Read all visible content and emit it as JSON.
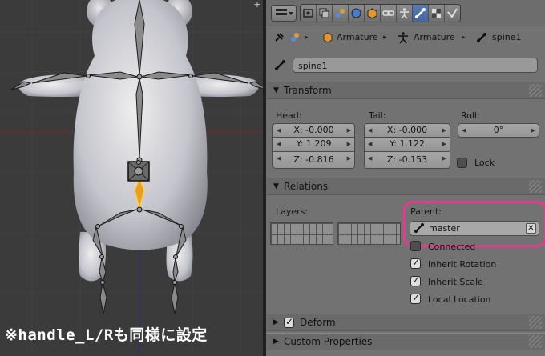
{
  "caption": "※handle_L/Rも同様に設定",
  "header": {
    "context_tabs": [
      "render-icon",
      "render-layers-icon",
      "scene-icon",
      "world-icon",
      "object-icon",
      "constraints-icon",
      "object-data-icon",
      "bone-icon",
      "bone-constraints-icon",
      "material-icon"
    ],
    "active_tab": "bone-icon"
  },
  "breadcrumb": {
    "item1": "Armature",
    "item2": "Armature",
    "item3": "spine1"
  },
  "bone_name": "spine1",
  "transform": {
    "title": "Transform",
    "head_label": "Head:",
    "tail_label": "Tail:",
    "roll_label": "Roll:",
    "head": {
      "x": "X: -0.000",
      "y": "Y: 1.209",
      "z": "Z: -0.816"
    },
    "tail": {
      "x": "X: -0.000",
      "y": "Y: 1.122",
      "z": "Z: -0.153"
    },
    "roll": "0°",
    "lock_label": "Lock",
    "lock": false
  },
  "relations": {
    "title": "Relations",
    "layers_label": "Layers:",
    "parent_label": "Parent:",
    "parent_value": "master",
    "connected_label": "Connected",
    "connected": false,
    "inherit_rotation_label": "Inherit Rotation",
    "inherit_rotation": true,
    "inherit_scale_label": "Inherit Scale",
    "inherit_scale": true,
    "local_location_label": "Local Location",
    "local_location": true
  },
  "deform": {
    "title": "Deform",
    "enabled": true
  },
  "custom_properties": {
    "title": "Custom Properties"
  },
  "colors": {
    "highlight": "#e8398e",
    "active_tab": "#5a7bb0",
    "viewport_bg": "#3b3b3b",
    "selected_bone": "#e8a020"
  }
}
